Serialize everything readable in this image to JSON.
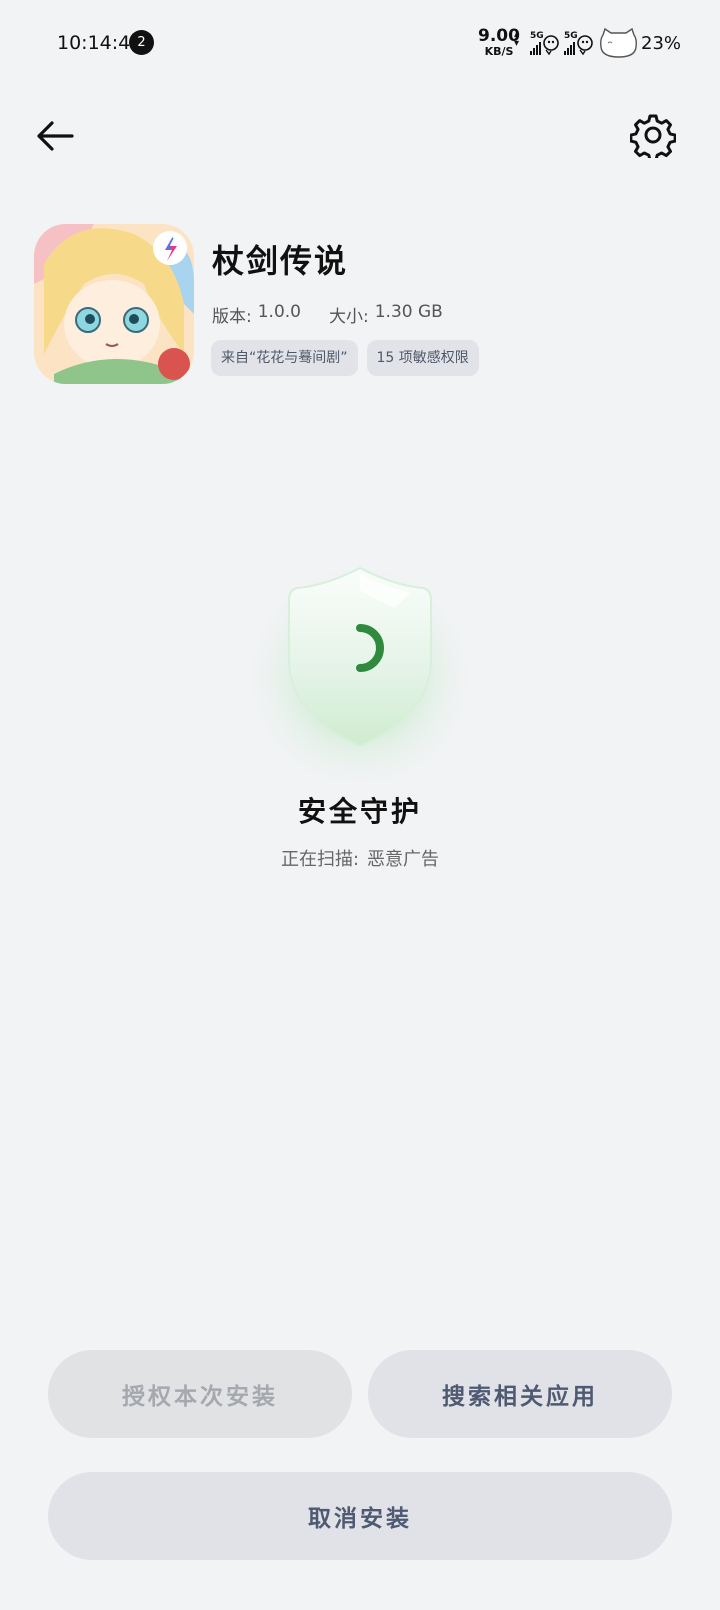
{
  "status_bar": {
    "time": "10:14:44",
    "notification_count": "2",
    "net_speed_value": "9.00",
    "net_speed_unit": "KB/S",
    "sim1_label": "5G",
    "sim2_label": "5G",
    "battery_percent": "23%"
  },
  "app": {
    "name": "杖剑传说",
    "version_label": "版本:",
    "version_value": "1.0.0",
    "size_label": "大小:",
    "size_value": "1.30 GB",
    "tags": [
      "来自“花花与蓦间剧”",
      "15 项敏感权限"
    ]
  },
  "scan": {
    "title": "安全守护",
    "status_label": "正在扫描:",
    "status_value": "恶意广告",
    "accent_color": "#2f8a3e"
  },
  "actions": {
    "authorize_label": "授权本次安装",
    "search_label": "搜索相关应用",
    "cancel_label": "取消安装"
  },
  "icons": {
    "back": "arrow-left-icon",
    "settings": "gear-icon"
  }
}
